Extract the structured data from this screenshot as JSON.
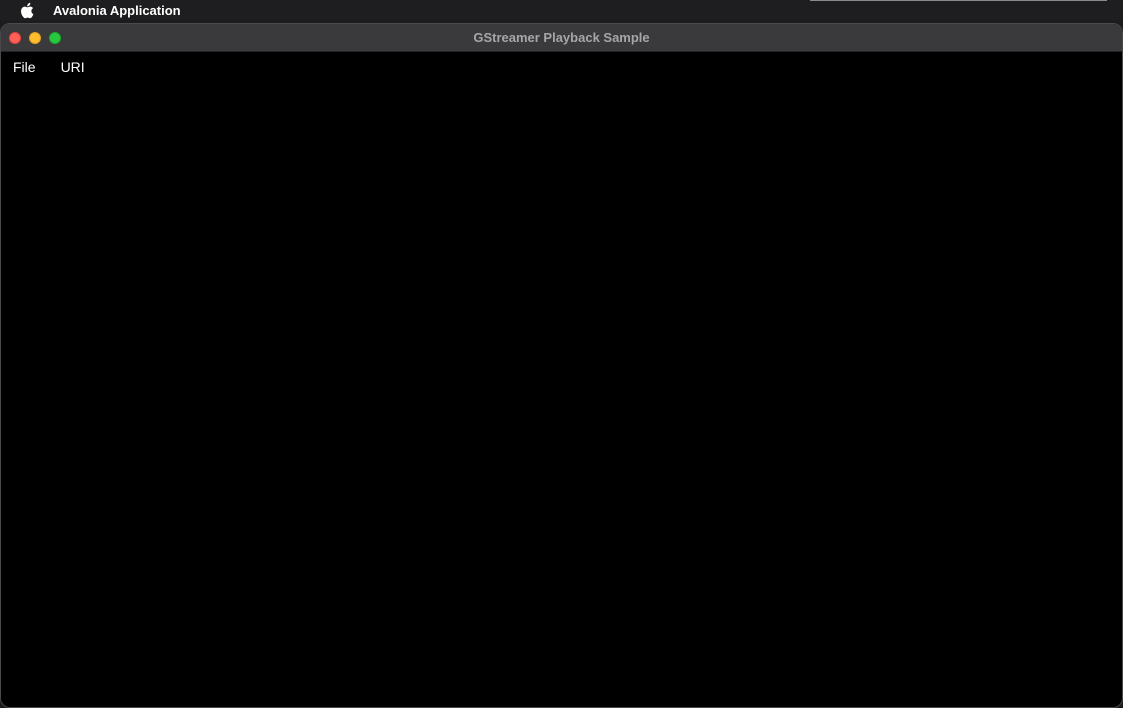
{
  "system_menubar": {
    "apple_icon": "apple-logo-icon",
    "app_name": "Avalonia Application"
  },
  "window": {
    "title": "GStreamer Playback Sample",
    "controls": [
      "close",
      "minimize",
      "maximize"
    ],
    "colors": {
      "close": "#fe5f57",
      "minimize": "#febc2e",
      "maximize": "#28c840"
    }
  },
  "app_menu": {
    "items": [
      {
        "label": "File"
      },
      {
        "label": "URI"
      }
    ]
  },
  "video_area": {
    "background": "#000000"
  }
}
